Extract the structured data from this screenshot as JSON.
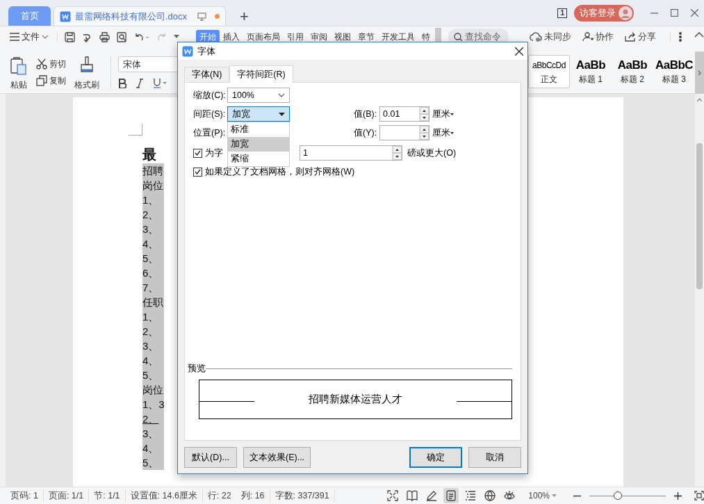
{
  "title_bar": {
    "tabs": [
      {
        "label": "首页",
        "kind": "home",
        "selected": false
      },
      {
        "label": "最需网络科技有限公司.docx",
        "kind": "document",
        "selected": true,
        "unsaved": true
      }
    ],
    "new_tab": "+",
    "page_count": "1",
    "login": "访客登录"
  },
  "toolbar": {
    "file_menu": "文件",
    "ribbon_tabs": [
      {
        "label": "开始",
        "selected": true
      },
      {
        "label": "插入",
        "selected": false
      },
      {
        "label": "页面布局",
        "selected": false
      },
      {
        "label": "引用",
        "selected": false
      },
      {
        "label": "审阅",
        "selected": false
      },
      {
        "label": "视图",
        "selected": false
      },
      {
        "label": "章节",
        "selected": false
      },
      {
        "label": "开发工具",
        "selected": false
      },
      {
        "label": "特",
        "selected": false
      }
    ],
    "search": {
      "placeholder": "查找命令"
    },
    "actions": [
      {
        "label": "未同步",
        "kind": "sync"
      },
      {
        "label": "协作",
        "kind": "collab"
      },
      {
        "label": "分享",
        "kind": "share"
      }
    ]
  },
  "ribbon": {
    "paste": "粘贴",
    "cut": "剪切",
    "copy": "复制",
    "format_painter": "格式刷",
    "font_name": "宋体",
    "styles": [
      {
        "sample": "aBbCcDd",
        "label": "正文",
        "selected": true
      },
      {
        "sample": "AaBb",
        "label": "标题 1",
        "selected": false
      },
      {
        "sample": "AaBb",
        "label": "标题 2",
        "selected": false
      },
      {
        "sample": "AaBbC",
        "label": "标题 3",
        "selected": false
      }
    ]
  },
  "document": {
    "heading": "最",
    "selected": true,
    "lines": [
      {
        "text": "招聘",
        "underlined": false
      },
      {
        "text": "岗位",
        "underlined": false
      },
      {
        "text": "1、",
        "underlined": false
      },
      {
        "text": "2、",
        "underlined": false
      },
      {
        "text": "3、",
        "underlined": false
      },
      {
        "text": "4、",
        "underlined": false
      },
      {
        "text": "5、",
        "underlined": false
      },
      {
        "text": "6、",
        "underlined": false
      },
      {
        "text": "7、",
        "underlined": false
      },
      {
        "text": "任职",
        "underlined": false
      },
      {
        "text": "1、",
        "underlined": false
      },
      {
        "text": "2、",
        "underlined": false
      },
      {
        "text": "3、",
        "underlined": false
      },
      {
        "text": "4、",
        "underlined": false
      },
      {
        "text": "5、",
        "underlined": false
      },
      {
        "text": "岗位",
        "underlined": false
      },
      {
        "text": "1、3",
        "underlined": false
      },
      {
        "text": "2、",
        "underlined": true
      },
      {
        "text": "3、",
        "underlined": false
      },
      {
        "text": "4、",
        "underlined": false
      },
      {
        "text": "5、",
        "underlined": false
      }
    ]
  },
  "dialog": {
    "title": "字体",
    "tabs": [
      {
        "label": "字体(N)",
        "selected": false
      },
      {
        "label": "字符间距(R)",
        "selected": true
      }
    ],
    "scale": {
      "label": "缩放(C):",
      "value": "100%"
    },
    "spacing": {
      "label": "间距(S):",
      "value": "加宽",
      "expanded": true,
      "options": [
        {
          "label": "标准",
          "selected": false
        },
        {
          "label": "加宽",
          "selected": true
        },
        {
          "label": "紧缩",
          "selected": false
        }
      ]
    },
    "spacing_value": {
      "label": "值(B):",
      "value": "0.01",
      "unit": "厘米"
    },
    "position": {
      "label": "位置(P):"
    },
    "position_value": {
      "label": "值(Y):",
      "unit": "厘米"
    },
    "kerning": {
      "label": "为字",
      "checked": true,
      "value": "1",
      "suffix": "磅或更大(O)"
    },
    "snap_grid": {
      "label": "如果定义了文档网格，则对齐网格(W)",
      "checked": true
    },
    "preview": {
      "label": "预览",
      "text": "招聘新媒体运营人才"
    },
    "buttons": [
      {
        "label": "默认(D)...",
        "kind": "normal"
      },
      {
        "label": "文本效果(E)...",
        "kind": "normal"
      },
      {
        "label": "确定",
        "kind": "default"
      },
      {
        "label": "取消",
        "kind": "normal"
      }
    ]
  },
  "status_bar": {
    "items": [
      "页码: 1",
      "页面: 1/1",
      "节: 1/1",
      "设置值: 14.6厘米",
      "行: 22",
      "列: 16",
      "字数: 337/391"
    ],
    "views": [
      {
        "kind": "fullscreen",
        "selected": false
      },
      {
        "kind": "reading",
        "selected": false
      },
      {
        "kind": "pen",
        "selected": false
      },
      {
        "kind": "page",
        "selected": true
      },
      {
        "kind": "outline",
        "selected": false
      },
      {
        "kind": "web",
        "selected": false
      },
      {
        "kind": "eye",
        "selected": false
      }
    ],
    "zoom": "100%",
    "zoom_slider": {
      "level": 0.37
    }
  }
}
